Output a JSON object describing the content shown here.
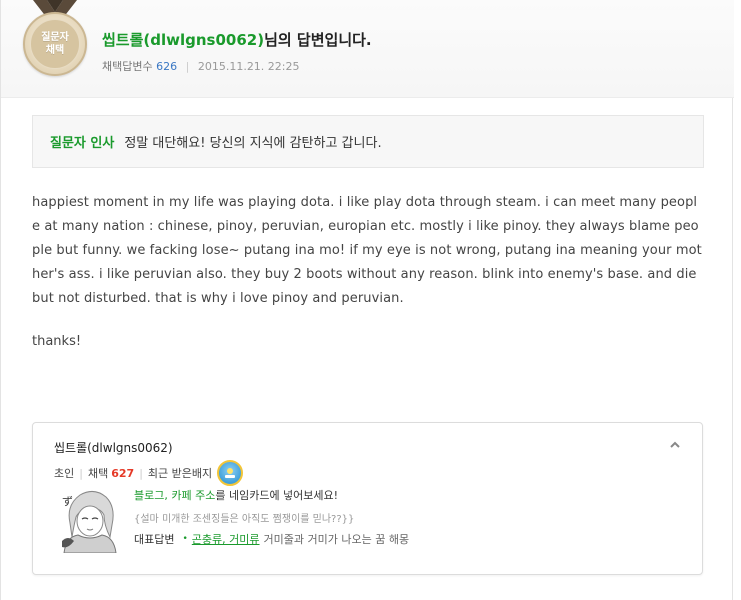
{
  "header": {
    "medal_line1": "질문자",
    "medal_line2": "채택",
    "author_display": "씹트롤(dlwlgns0062)",
    "title_suffix": "님의 답변입니다.",
    "adopted_label": "채택답변수",
    "adopted_count": "626",
    "date": "2015.11.21. 22:25"
  },
  "greeting": {
    "label": "질문자 인사",
    "text": "정말 대단해요! 당신의 지식에 감탄하고 갑니다."
  },
  "answer": {
    "body": "happiest moment in my life was playing dota. i like play dota through steam. i can meet many people at many nation : chinese, pinoy, peruvian, europian etc. mostly i like pinoy. they always blame people but funny. we facking lose~ putang ina mo! if my eye is not wrong, putang ina meaning your mother's ass. i like peruvian also. they buy 2 boots without any reason. blink into enemy's base. and die but not disturbed. that is why i love pinoy and peruvian.",
    "closing": "thanks!"
  },
  "profile": {
    "name": "씹트롤(dlwlgns0062)",
    "level": "초인",
    "adopt_label": "채택",
    "adopt_count": "627",
    "badge_label": "최근 받은배지",
    "promo_link": "블로그, 카페 주소",
    "promo_rest": "를 네임카드에 넣어보세요!",
    "comment": "{설마 미개한 조센징들은 아직도 쩜쟁이를 믿나??}}",
    "rep_label": "대표답변",
    "rep_link": "곤충류, 거미류",
    "rep_rest": "거미줄과 거미가 나오는 꿈 해몽"
  },
  "colors": {
    "accent_green": "#1a9a2c",
    "count_blue": "#3b78c4",
    "count_red": "#e53a28"
  },
  "icons": [
    "medal-icon",
    "chevron-up-icon",
    "badge-icon",
    "avatar-illustration"
  ]
}
